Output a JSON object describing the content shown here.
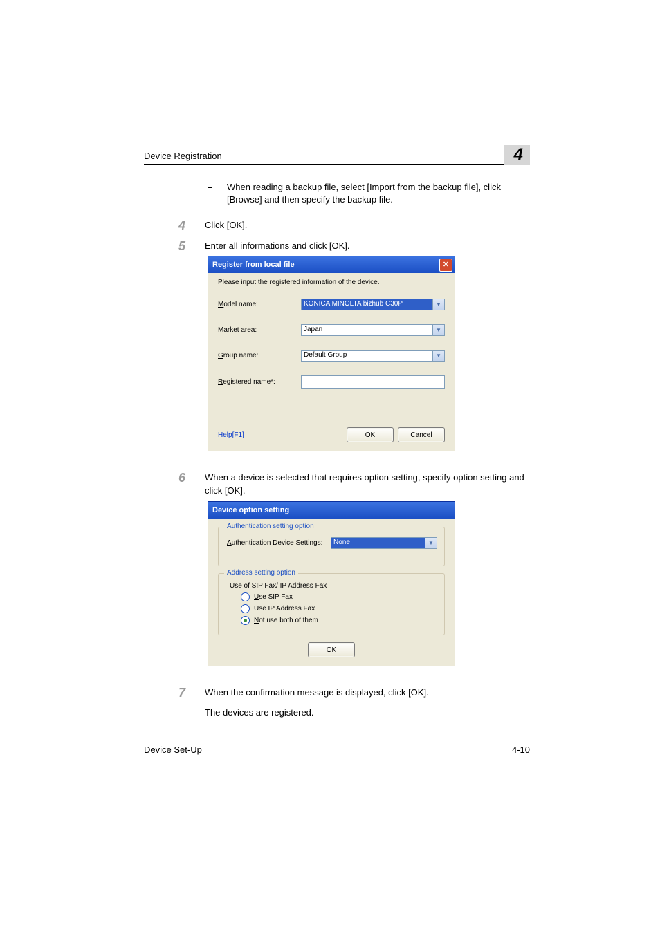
{
  "header": {
    "title": "Device Registration",
    "chapter": "4"
  },
  "bullet": {
    "dash": "–",
    "text": "When reading a backup file, select [Import from the backup file], click [Browse] and then specify the backup file."
  },
  "step4": {
    "num": "4",
    "text": "Click [OK]."
  },
  "step5": {
    "num": "5",
    "text": "Enter all informations and click [OK]."
  },
  "dlg1": {
    "title": "Register from local file",
    "instr": "Please input the registered information of the device.",
    "model_lbl": "Model name:",
    "model_val": "KONICA MINOLTA bizhub C30P",
    "market_lbl": "Market area:",
    "market_val": "Japan",
    "group_lbl": "Group name:",
    "group_val": "Default Group",
    "reg_lbl": "Registered name*:",
    "reg_val": "",
    "help": "Help[F1]",
    "ok": "OK",
    "cancel": "Cancel"
  },
  "step6": {
    "num": "6",
    "text": "When a device is selected that requires option setting, specify option setting and click [OK]."
  },
  "dlg2": {
    "title": "Device option setting",
    "auth_legend": "Authentication setting option",
    "auth_lbl": "Authentication Device Settings:",
    "auth_val": "None",
    "addr_legend": "Address setting option",
    "addr_head": "Use of SIP Fax/ IP Address Fax",
    "opt1": "Use SIP Fax",
    "opt2": "Use IP Address Fax",
    "opt3": "Not use both of them",
    "ok": "OK"
  },
  "step7": {
    "num": "7",
    "text": "When the confirmation message is displayed, click [OK].",
    "text2": "The devices are registered."
  },
  "footer": {
    "left": "Device Set-Up",
    "right": "4-10"
  }
}
